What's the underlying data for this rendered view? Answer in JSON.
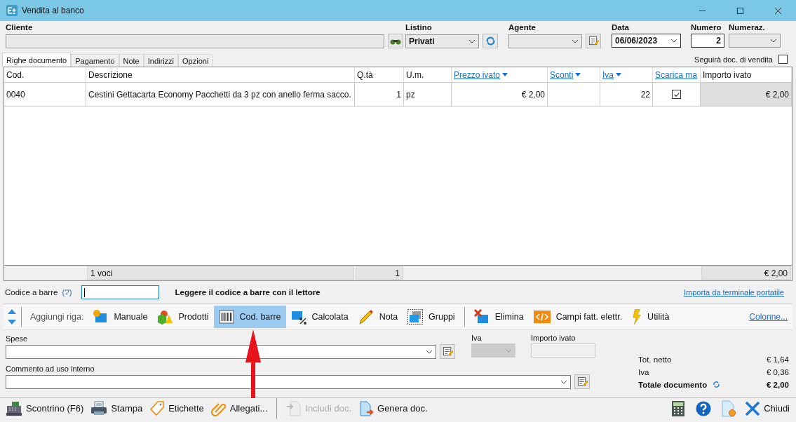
{
  "window": {
    "title": "Vendita al banco"
  },
  "header": {
    "cliente": {
      "label": "Cliente"
    },
    "listino": {
      "label": "Listino",
      "value": "Privati"
    },
    "agente": {
      "label": "Agente"
    },
    "data": {
      "label": "Data",
      "value": "06/06/2023"
    },
    "numero": {
      "label": "Numero",
      "value": "2"
    },
    "numerazione": {
      "label": "Numeraz."
    }
  },
  "tabs": [
    {
      "label": "Righe documento",
      "selected": true
    },
    {
      "label": "Pagamento",
      "selected": false
    },
    {
      "label": "Note",
      "selected": false
    },
    {
      "label": "Indirizzi",
      "selected": false
    },
    {
      "label": "Opzioni",
      "selected": false
    }
  ],
  "follow_checkbox": {
    "label": "Seguirà doc. di vendita",
    "checked": false
  },
  "table": {
    "columns": [
      {
        "label": "Cod.",
        "kind": "plain"
      },
      {
        "label": "Descrizione",
        "kind": "plain"
      },
      {
        "label": "Q.tà",
        "kind": "plain"
      },
      {
        "label": "U.m.",
        "kind": "plain"
      },
      {
        "label": "Prezzo ivato",
        "kind": "sort"
      },
      {
        "label": "Sconti",
        "kind": "sort"
      },
      {
        "label": "Iva",
        "kind": "sort"
      },
      {
        "label": "Scarica ma",
        "kind": "link"
      },
      {
        "label": "Importo ivato",
        "kind": "plain"
      }
    ],
    "rows": [
      {
        "cod": "0040",
        "descrizione": "Cestini Gettacarta Economy Pacchetti da 3 pz con anello ferma sacco.",
        "qta": "1",
        "um": "pz",
        "prezzo": "€ 2,00",
        "iva": "22",
        "scarica": true,
        "importo": "€ 2,00"
      }
    ],
    "footer": {
      "voci": "1 voci",
      "qta": "1",
      "importo": "€ 2,00"
    }
  },
  "barcode": {
    "label": "Codice a barre",
    "help": "(?)",
    "hint": "Leggere il codice a barre con il lettore",
    "link": "Importa da terminale portatile"
  },
  "toolbar": {
    "label": "Aggiungi riga:",
    "add_buttons": [
      {
        "label": "Manuale",
        "kind": "manual",
        "selected": false
      },
      {
        "label": "Prodotti",
        "kind": "products",
        "selected": false
      },
      {
        "label": "Cod. barre",
        "kind": "barcode",
        "selected": true
      },
      {
        "label": "Calcolata",
        "kind": "calc",
        "selected": false
      },
      {
        "label": "Nota",
        "kind": "note",
        "selected": false
      },
      {
        "label": "Gruppi",
        "kind": "groups",
        "selected": false
      }
    ],
    "other_buttons": [
      {
        "label": "Elimina",
        "kind": "delete",
        "selected": false
      },
      {
        "label": "Campi fatt. elettr.",
        "kind": "code",
        "selected": false
      },
      {
        "label": "Utilità",
        "kind": "bolt",
        "selected": false
      }
    ],
    "link": "Colonne..."
  },
  "spese": {
    "label": "Spese"
  },
  "iva": {
    "label": "Iva",
    "disabled": true
  },
  "importo": {
    "label": "Importo ivato"
  },
  "commento": {
    "label": "Commento ad uso interno"
  },
  "totals": [
    {
      "label": "Tot. netto",
      "value": "€ 1,64",
      "bold": false
    },
    {
      "label": "Iva",
      "value": "€ 0,36",
      "bold": false
    },
    {
      "label": "Totale documento",
      "value": "€ 2,00",
      "bold": true
    }
  ],
  "bottom_buttons": [
    {
      "label": "Scontrino (F6)",
      "kind": "register",
      "disabled": false
    },
    {
      "label": "Stampa",
      "kind": "printer",
      "disabled": false
    },
    {
      "label": "Etichette",
      "kind": "tag",
      "disabled": false
    },
    {
      "label": "Allegati...",
      "kind": "clip",
      "disabled": false
    },
    {
      "label": "Includi doc.",
      "kind": "include",
      "disabled": true
    },
    {
      "label": "Genera doc.",
      "kind": "generate",
      "disabled": false
    }
  ],
  "close_button": {
    "label": "Chiudi"
  }
}
